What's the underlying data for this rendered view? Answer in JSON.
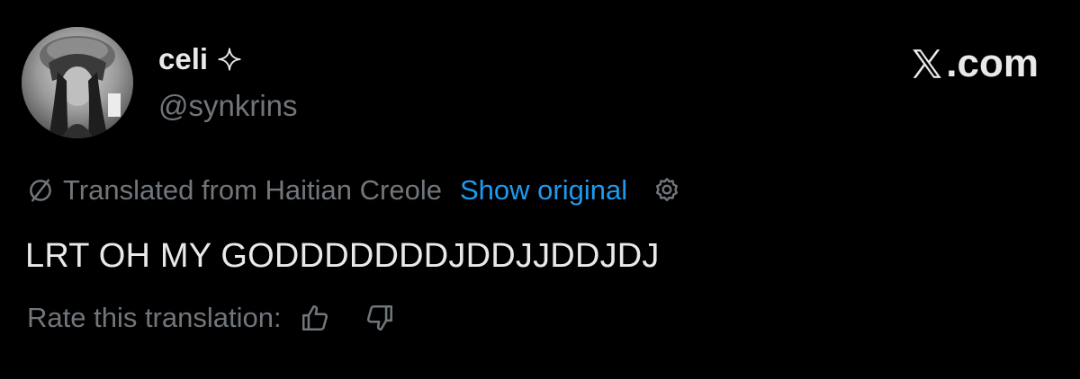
{
  "author": {
    "display_name": "celi",
    "handle": "@synkrins",
    "badge_icon": "sparkle-icon"
  },
  "brand": {
    "label": ".com",
    "logo_icon": "x-logo-icon"
  },
  "translation": {
    "status_text": "Translated from Haitian Creole",
    "show_original_label": "Show original",
    "translate_icon": "translate-icon",
    "settings_icon": "gear-icon"
  },
  "tweet": {
    "text": "LRT OH MY GODDDDDDDJDDJJDDJDJ"
  },
  "rating": {
    "label": "Rate this translation:",
    "up_icon": "thumbs-up-icon",
    "down_icon": "thumbs-down-icon"
  },
  "colors": {
    "background": "#000000",
    "primary_text": "#e7e9ea",
    "secondary_text": "#71767b",
    "link": "#1d9bf0"
  }
}
